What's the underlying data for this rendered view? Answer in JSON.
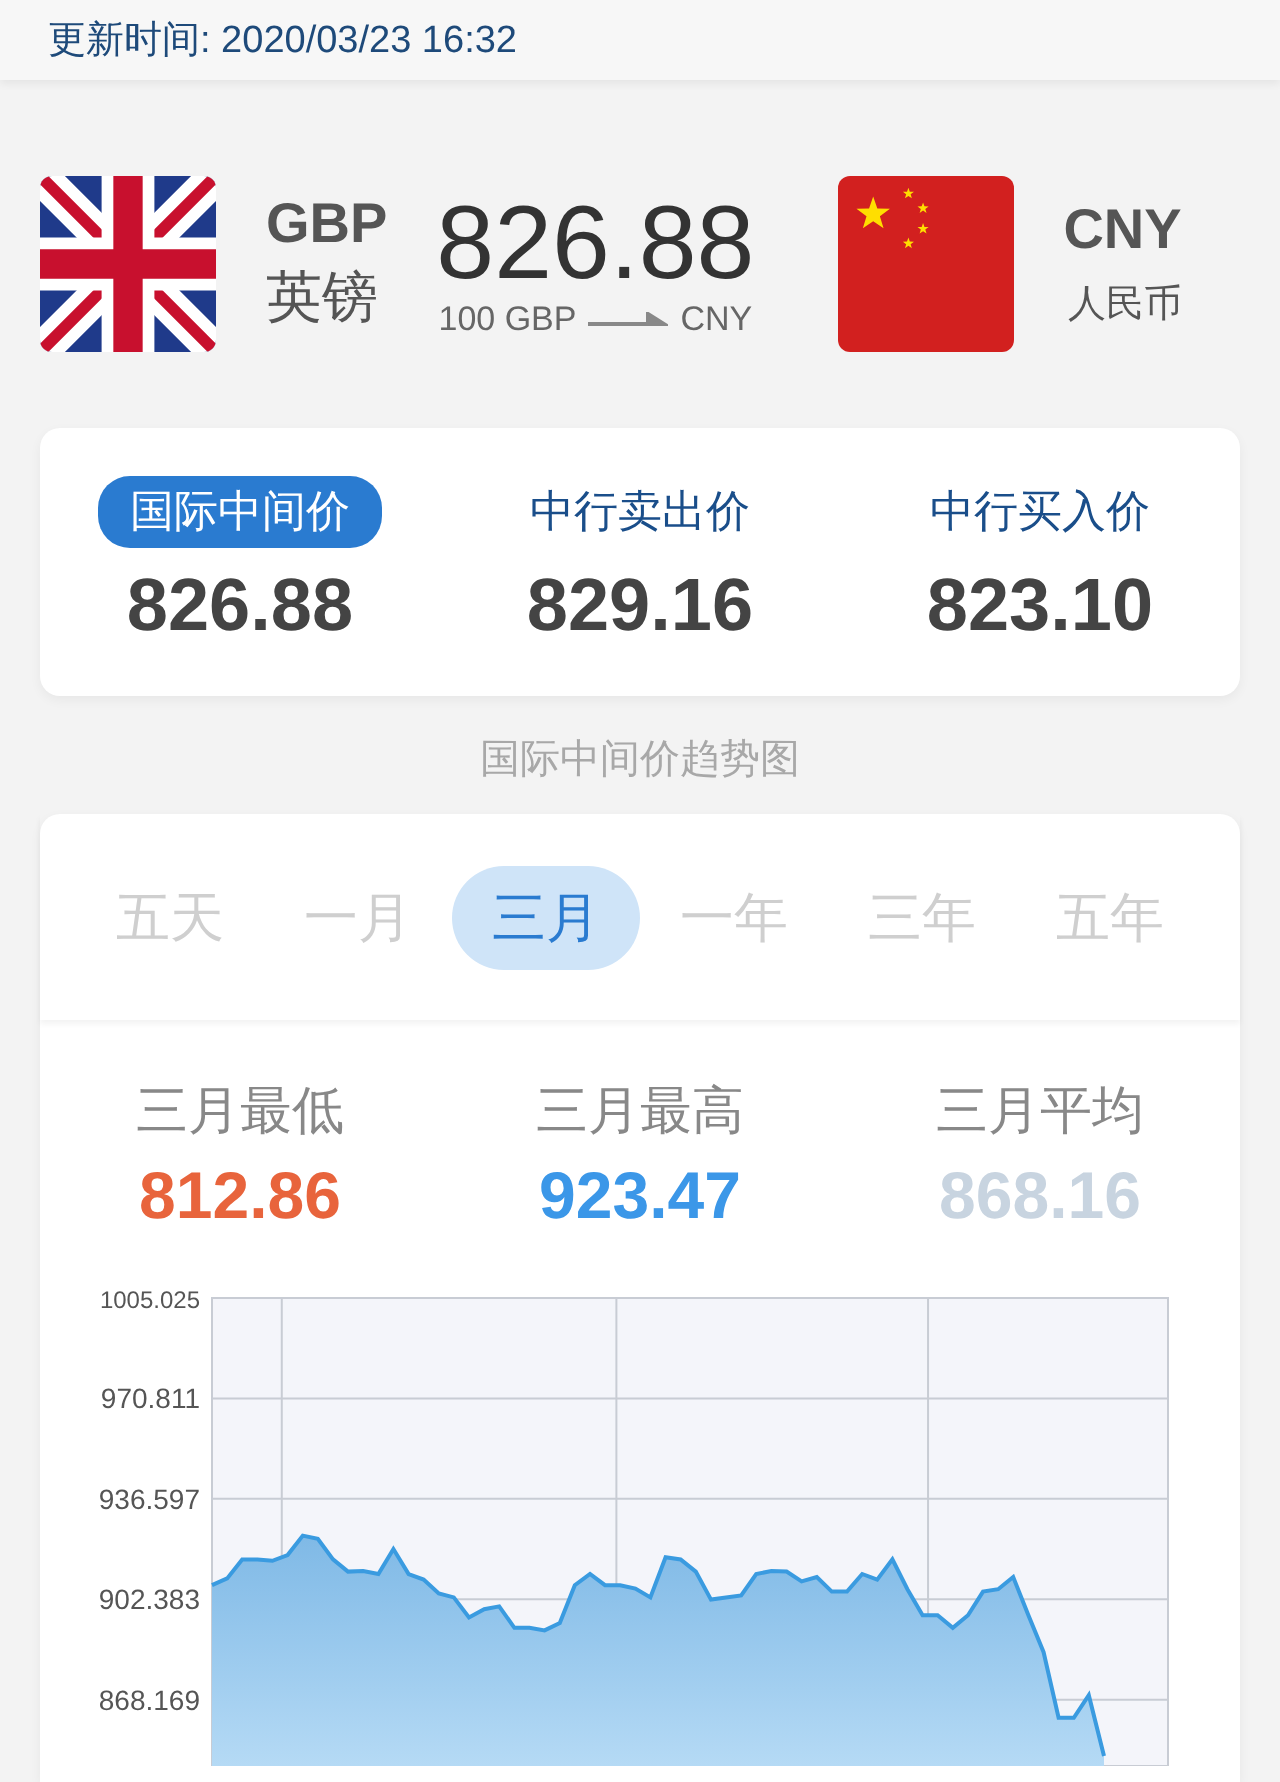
{
  "update_time": "更新时间: 2020/03/23 16:32",
  "conversion": {
    "from_code": "GBP",
    "from_name": "英镑",
    "rate": "826.88",
    "amount": "100 GBP",
    "to_code_small": "CNY",
    "to_code": "CNY",
    "to_name": "人民币"
  },
  "prices": [
    {
      "label": "国际中间价",
      "value": "826.88",
      "selected": true
    },
    {
      "label": "中行卖出价",
      "value": "829.16",
      "selected": false
    },
    {
      "label": "中行买入价",
      "value": "823.10",
      "selected": false
    }
  ],
  "trend_title": "国际中间价趋势图",
  "periods": [
    {
      "label": "五天",
      "selected": false
    },
    {
      "label": "一月",
      "selected": false
    },
    {
      "label": "三月",
      "selected": true
    },
    {
      "label": "一年",
      "selected": false
    },
    {
      "label": "三年",
      "selected": false
    },
    {
      "label": "五年",
      "selected": false
    }
  ],
  "stats": [
    {
      "label": "三月最低",
      "value": "812.86",
      "color": "#e8643c"
    },
    {
      "label": "三月最高",
      "value": "923.47",
      "color": "#3b97e8"
    },
    {
      "label": "三月平均",
      "value": "868.16",
      "color": "#c8d4e0"
    }
  ],
  "chart_data": {
    "type": "area",
    "grid": true,
    "ylim": [
      845.6,
      1005.025
    ],
    "yticks": [
      {
        "value": 1005.025,
        "label": "1005.025"
      },
      {
        "value": 970.811,
        "label": "970.811"
      },
      {
        "value": 936.597,
        "label": "936.597"
      },
      {
        "value": 902.383,
        "label": "902.383"
      },
      {
        "value": 868.169,
        "label": "868.169"
      }
    ],
    "series": [
      {
        "color": "#3a9be0",
        "values": [
          907.2,
          909.5,
          915.9,
          916.0,
          915.5,
          917.5,
          924.1,
          923.0,
          916.0,
          911.8,
          912.0,
          911.0,
          919.5,
          911.0,
          909.1,
          904.4,
          903.0,
          896.2,
          899.0,
          900.0,
          892.7,
          892.7,
          891.8,
          894.3,
          907.2,
          911.0,
          907.2,
          907.2,
          906.0,
          903.0,
          916.7,
          916.0,
          911.8,
          902.3,
          903.0,
          903.7,
          911.0,
          912.0,
          911.8,
          908.5,
          910.0,
          905.0,
          905.0,
          911.0,
          909.1,
          916.0,
          905.8,
          897.0,
          897.0,
          892.7,
          897.0,
          905.0,
          905.8,
          910.0,
          897.0,
          884.4,
          862.0,
          862.0,
          869.7,
          849.0
        ]
      }
    ]
  }
}
